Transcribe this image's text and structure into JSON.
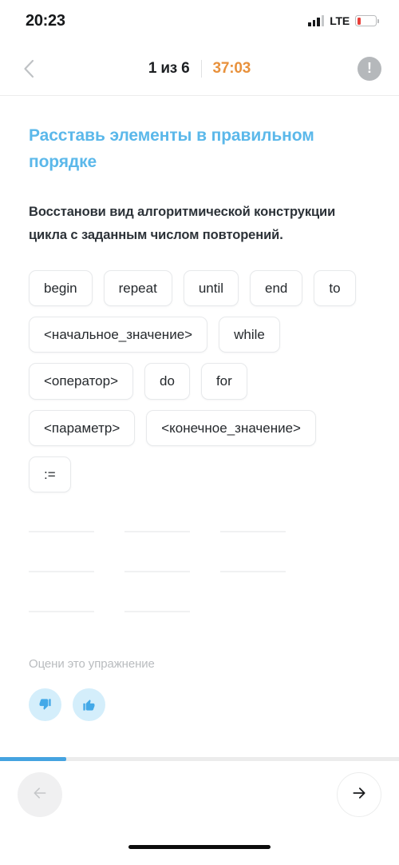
{
  "status_bar": {
    "time": "20:23",
    "network_label": "LTE",
    "signal_icon": "signal-bars-icon",
    "battery_icon": "battery-low-icon",
    "battery_percent": 22
  },
  "header": {
    "back_icon": "chevron-left-icon",
    "progress_count": "1 из 6",
    "timer": "37:03",
    "info_icon": "info-exclamation-icon",
    "info_glyph": "!"
  },
  "task": {
    "title": "Расставь элементы в правильном порядке",
    "prompt": "Восстанови вид алгоритмической конструкции цикла с заданным числом повторений."
  },
  "chips": [
    {
      "label": "begin"
    },
    {
      "label": "repeat"
    },
    {
      "label": "until"
    },
    {
      "label": "end"
    },
    {
      "label": "to"
    },
    {
      "label": "<начальное_значение>"
    },
    {
      "label": "while"
    },
    {
      "label": "<оператор>"
    },
    {
      "label": "do"
    },
    {
      "label": "for"
    },
    {
      "label": "<параметр>"
    },
    {
      "label": "<конечное_значение>"
    },
    {
      "label": ":="
    }
  ],
  "drop_slots": [
    {
      "value": ""
    },
    {
      "value": ""
    },
    {
      "value": ""
    },
    {
      "value": ""
    },
    {
      "value": ""
    },
    {
      "value": ""
    },
    {
      "value": ""
    },
    {
      "value": ""
    }
  ],
  "rating": {
    "label": "Оцени это упражнение",
    "thumbs_down_icon": "thumbs-down-icon",
    "thumbs_up_icon": "thumbs-up-icon"
  },
  "bottom": {
    "progress_percent": 16.6,
    "prev_icon": "arrow-left-icon",
    "next_icon": "arrow-right-icon",
    "home_indicator": "home-indicator"
  },
  "colors": {
    "title_blue": "#5bb8ea",
    "timer_orange": "#e8913c",
    "progress_blue": "#45a3e0",
    "rating_bg": "#d4eefb",
    "rating_icon": "#43a9e8",
    "battery_red": "#e8403a"
  }
}
